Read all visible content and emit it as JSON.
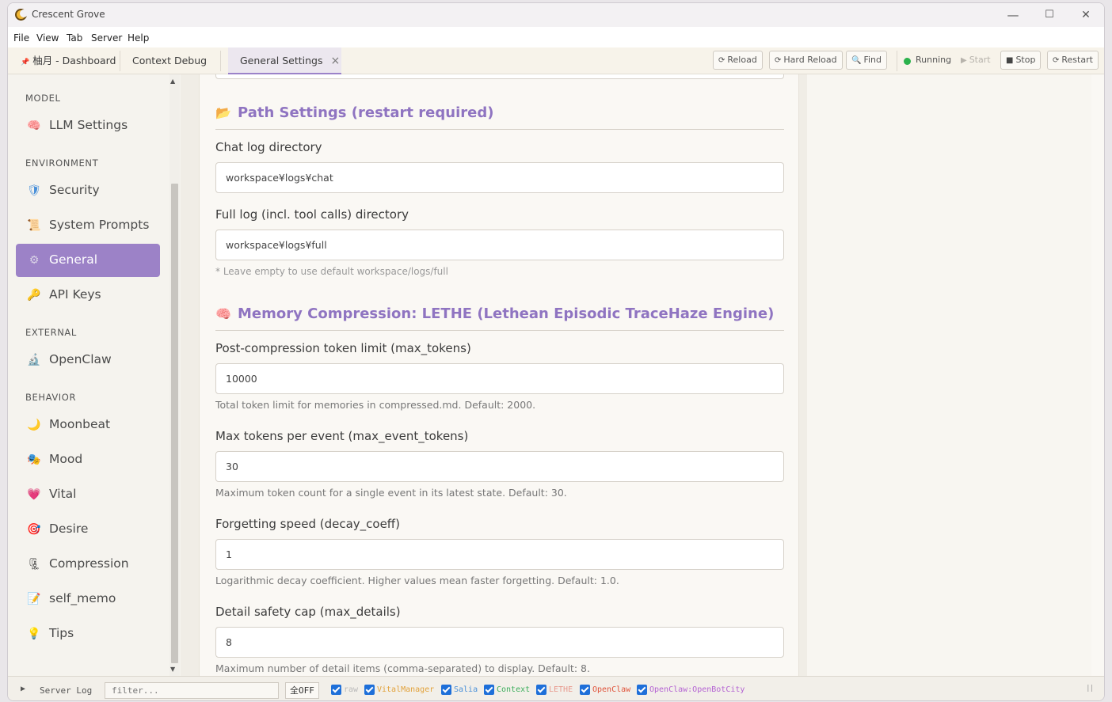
{
  "app": {
    "title": "Crescent Grove"
  },
  "window_controls": {
    "minimize": "—",
    "maximize": "☐",
    "close": "✕"
  },
  "menu": [
    "File",
    "View",
    "Tab",
    "Server",
    "Help"
  ],
  "tabs": [
    {
      "pin": "📌",
      "label": "柚月 - Dashboard"
    },
    {
      "label": "Context Debug"
    },
    {
      "label": "General Settings",
      "close": "×"
    }
  ],
  "toolbar": {
    "reload": "Reload",
    "hard_reload": "Hard Reload",
    "find": "Find",
    "status": "Running",
    "start": "Start",
    "stop": "Stop",
    "restart": "Restart"
  },
  "sidebar": {
    "sections": {
      "model": "MODEL",
      "environment": "ENVIRONMENT",
      "external": "EXTERNAL",
      "behavior": "BEHAVIOR"
    },
    "items": {
      "llm": {
        "icon": "🧠",
        "label": "LLM Settings"
      },
      "security": {
        "icon": "🛡",
        "label": "Security"
      },
      "prompts": {
        "icon": "📜",
        "label": "System Prompts"
      },
      "general": {
        "icon": "⚙",
        "label": "General"
      },
      "api": {
        "icon": "🔑",
        "label": "API Keys"
      },
      "openclaw": {
        "icon": "🔬",
        "label": "OpenClaw"
      },
      "moonbeat": {
        "icon": "🌙",
        "label": "Moonbeat"
      },
      "mood": {
        "icon": "🎭",
        "label": "Mood"
      },
      "vital": {
        "icon": "💗",
        "label": "Vital"
      },
      "desire": {
        "icon": "🎯",
        "label": "Desire"
      },
      "compression": {
        "icon": "🗜",
        "label": "Compression"
      },
      "self_memo": {
        "icon": "📝",
        "label": "self_memo"
      },
      "tips": {
        "icon": "💡",
        "label": "Tips"
      }
    }
  },
  "main": {
    "path_settings": {
      "icon": "📂",
      "title": "Path Settings (restart required)",
      "chat_log_label": "Chat log directory",
      "chat_log_value": "workspace¥logs¥chat",
      "full_log_label": "Full log (incl. tool calls) directory",
      "full_log_value": "workspace¥logs¥full",
      "full_log_note": "* Leave empty to use default workspace/logs/full"
    },
    "memory": {
      "icon": "🧠",
      "title": "Memory Compression: LETHE (Lethean Episodic TraceHaze Engine)",
      "max_tokens_label": "Post-compression token limit (max_tokens)",
      "max_tokens_value": "10000",
      "max_tokens_help": "Total token limit for memories in compressed.md. Default: 2000.",
      "max_event_label": "Max tokens per event (max_event_tokens)",
      "max_event_value": "30",
      "max_event_help": "Maximum token count for a single event in its latest state. Default: 30.",
      "decay_label": "Forgetting speed (decay_coeff)",
      "decay_value": "1",
      "decay_help": "Logarithmic decay coefficient. Higher values mean faster forgetting. Default: 1.0.",
      "details_label": "Detail safety cap (max_details)",
      "details_value": "8",
      "details_help": "Maximum number of detail items (comma-separated) to display. Default: 8."
    }
  },
  "bottombar": {
    "toggle": "▶",
    "title": "Server Log",
    "filter_placeholder": "filter...",
    "all_off": "全OFF",
    "filters": [
      {
        "label": "raw",
        "color": "#b9b9b9"
      },
      {
        "label": "VitalManager",
        "color": "#e2a23b"
      },
      {
        "label": "Salia",
        "color": "#4a90d9"
      },
      {
        "label": "Context",
        "color": "#3cae5c"
      },
      {
        "label": "LETHE",
        "color": "#e89a8e"
      },
      {
        "label": "OpenClaw",
        "color": "#e0533a"
      },
      {
        "label": "OpenClaw:OpenBotCity",
        "color": "#b463d3"
      }
    ],
    "pause": "||"
  }
}
